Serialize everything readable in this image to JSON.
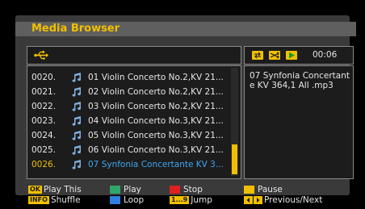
{
  "title": "Media Browser",
  "path_icon": "usb-icon",
  "files": [
    {
      "num": "0020.",
      "name": "01 Violin Concerto No.2,KV 21..."
    },
    {
      "num": "0021.",
      "name": "02 Violin Concerto No.2,KV 21..."
    },
    {
      "num": "0022.",
      "name": "03 Violin Concerto No.2,KV 21..."
    },
    {
      "num": "0023.",
      "name": "04 Violin Concerto No.3,KV 21..."
    },
    {
      "num": "0024.",
      "name": "05 Violin Concerto No.3,KV 21..."
    },
    {
      "num": "0025.",
      "name": "06 Violin Concerto No.3,KV 21..."
    },
    {
      "num": "0026.",
      "name": "07 Synfonia Concertante KV 3..."
    }
  ],
  "selected_index": 6,
  "player": {
    "time": "00:06",
    "controls": [
      "repeat-icon",
      "shuffle-icon",
      "play-icon"
    ],
    "control_colors": [
      "#f0c000",
      "#f0c000",
      "#f0c000"
    ]
  },
  "info": {
    "filename": "07 Synfonia Concertante KV 364,1 All .mp3"
  },
  "legend": {
    "ok_key": "OK",
    "play_this": "Play This",
    "info_key": "INFO",
    "shuffle": "Shuffle",
    "play": "Play",
    "loop": "Loop",
    "stop": "Stop",
    "jump_key": "1...9",
    "jump": "Jump",
    "pause": "Pause",
    "prev_next": "Previous/Next",
    "colors": {
      "green": "#2fa66a",
      "blue": "#2f7fe0",
      "red": "#e02020",
      "yellow": "#f0c000"
    }
  }
}
